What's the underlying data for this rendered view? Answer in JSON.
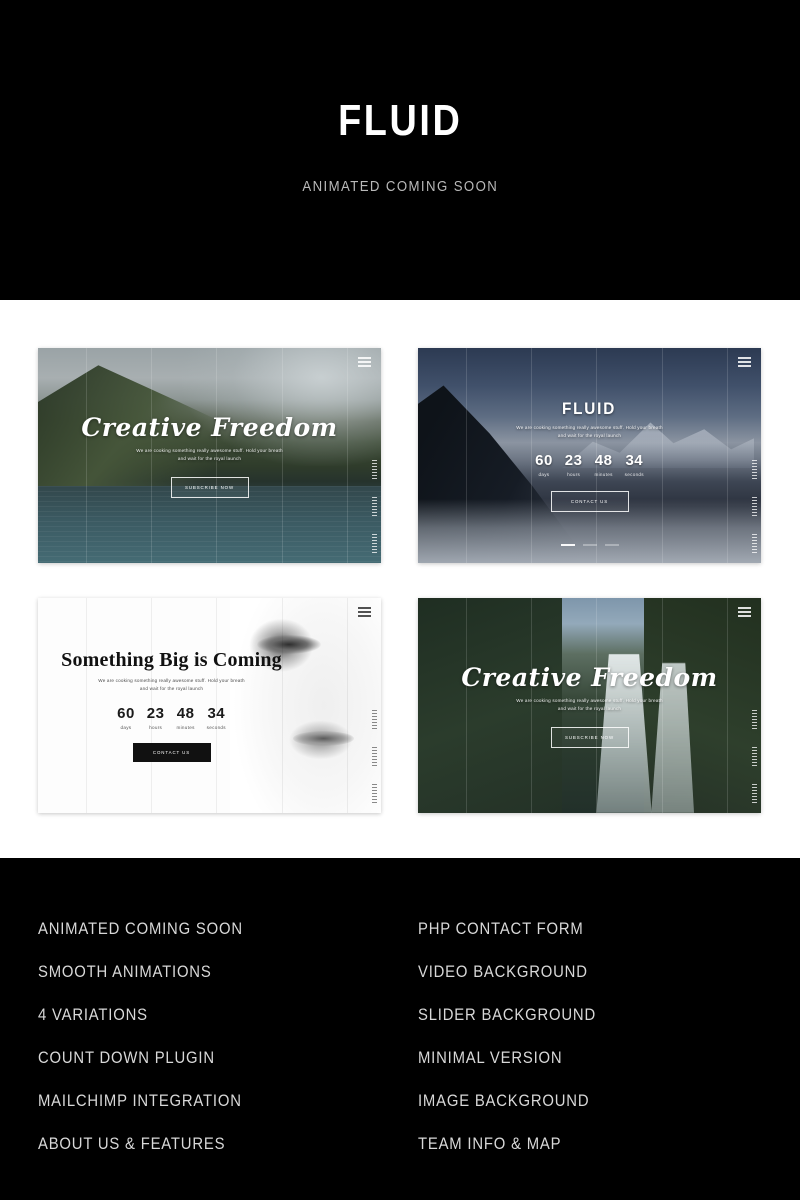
{
  "header": {
    "title": "FLUID",
    "subtitle": "ANIMATED COMING SOON"
  },
  "colors": {
    "header_bg": "#000000",
    "gallery_bg": "#ffffff",
    "features_bg": "#000000",
    "title_color": "#ffffff",
    "subtitle_color": "#b9b9b9",
    "feature_color": "#d8d8d8"
  },
  "common": {
    "tagline_line1": "We are cooking something really awesome stuff. Hold your breath",
    "tagline_line2": "and wait for the royal launch",
    "countdown": [
      {
        "value": "60",
        "label": "days"
      },
      {
        "value": "23",
        "label": "hours"
      },
      {
        "value": "48",
        "label": "minutes"
      },
      {
        "value": "34",
        "label": "seconds"
      }
    ],
    "menu_icon": "hamburger-icon"
  },
  "previews": [
    {
      "id": "preview-creative-freedom-lake",
      "heading": "Creative Freedom",
      "button": "SUBSCRIBE NOW",
      "scene": "foggy lake and green mountains"
    },
    {
      "id": "preview-fluid-mountains",
      "heading": "FLUID",
      "button": "CONTACT US",
      "scene": "dusk snowy mountains with fog",
      "slider_indicators": 3,
      "active_indicator": 1
    },
    {
      "id": "preview-minimal-something-big",
      "heading": "Something Big is Coming",
      "button": "CONTACT US",
      "scene": "minimal white with portrait"
    },
    {
      "id": "preview-creative-freedom-waterfall",
      "heading": "Creative Freedom",
      "button": "SUBSCRIBE NOW",
      "scene": "waterfall in jungle"
    }
  ],
  "features": {
    "left": [
      "ANIMATED COMING SOON",
      "SMOOTH ANIMATIONS",
      "4 VARIATIONS",
      "COUNT DOWN PLUGIN",
      "MAILCHIMP INTEGRATION",
      "ABOUT US & FEATURES"
    ],
    "right": [
      "PHP CONTACT FORM",
      "VIDEO BACKGROUND",
      "SLIDER BACKGROUND",
      "MINIMAL VERSION",
      "IMAGE BACKGROUND",
      "TEAM INFO & MAP"
    ]
  }
}
